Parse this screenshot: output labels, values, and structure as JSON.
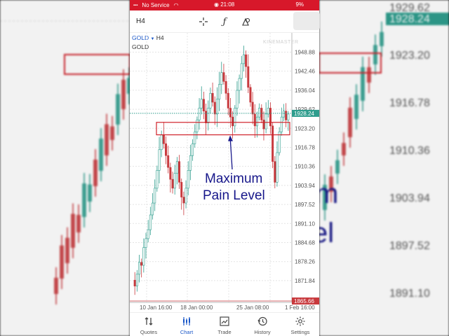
{
  "status": {
    "carrier": "No Service",
    "time": "21:08",
    "battery": "9%"
  },
  "toolbar": {
    "timeframe": "H4",
    "icons": [
      "crosshair-icon",
      "function-icon",
      "objects-icon"
    ]
  },
  "symbol": {
    "name": "GOLD",
    "timeframe": "H4",
    "description": "GOLD"
  },
  "chart_data": {
    "type": "candlestick",
    "price_axis_labels": [
      "1948.88",
      "1942.46",
      "1936.04",
      "1929.62",
      "1923.20",
      "1916.78",
      "1910.36",
      "1903.94",
      "1897.52",
      "1891.10",
      "1884.68",
      "1878.26",
      "1871.84"
    ],
    "time_axis_labels": [
      "10 Jan 16:00",
      "18 Jan 00:00",
      "25 Jan 08:00",
      "1 Feb 16:00"
    ],
    "bid_price": "1928.24",
    "low_price_label": "1865.66",
    "annotation": [
      "Maximum",
      "Pain Level"
    ],
    "resistance_zone": [
      1921.0,
      1925.2
    ],
    "grid": true
  },
  "background_overlay": {
    "left_text": [
      "Maximum",
      "Pain Level"
    ],
    "right_prices": [
      "1929.62",
      "1928.24",
      "1923.20",
      "1916.78",
      "1910.36",
      "1903.94",
      "1897.52",
      "1891.10"
    ],
    "right_text_fragments": [
      "m",
      "el"
    ]
  },
  "watermark": "KINEMASTER",
  "bottom_nav": [
    {
      "label": "Quotes",
      "icon": "quotes-icon",
      "active": false
    },
    {
      "label": "Chart",
      "icon": "chart-icon",
      "active": true
    },
    {
      "label": "Trade",
      "icon": "trade-icon",
      "active": false
    },
    {
      "label": "History",
      "icon": "history-icon",
      "active": false
    },
    {
      "label": "Settings",
      "icon": "settings-icon",
      "active": false
    }
  ],
  "colors": {
    "up": "#2e9d8d",
    "down": "#c8393d",
    "accent": "#1a57c8",
    "statusbar": "#d7182a",
    "annotation": "#17178a"
  }
}
